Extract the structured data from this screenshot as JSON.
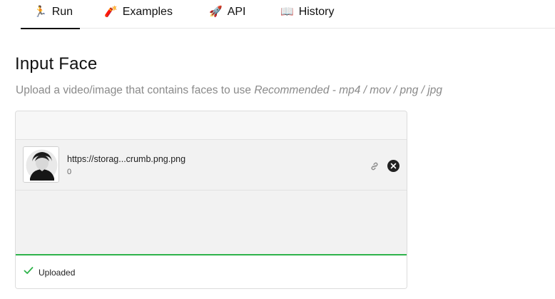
{
  "tabs": [
    {
      "icon": "🏃",
      "label": "Run",
      "active": true
    },
    {
      "icon": "🧨",
      "label": "Examples",
      "active": false
    },
    {
      "icon": "🚀",
      "label": "API",
      "active": false
    },
    {
      "icon": "📖",
      "label": "History",
      "active": false
    }
  ],
  "input": {
    "title": "Input Face",
    "description": "Upload a video/image that contains faces to use ",
    "hint": "Recommended - mp4 / mov / png / jpg"
  },
  "file": {
    "name": "https://storag...crumb.png.png",
    "size": "0"
  },
  "status": {
    "text": "Uploaded",
    "color": "#2fb34b"
  }
}
